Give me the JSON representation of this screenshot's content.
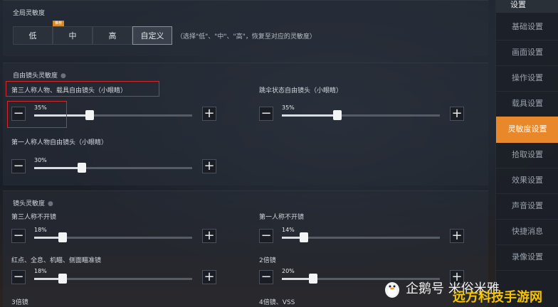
{
  "sections": {
    "global": {
      "title": "全局灵敏度",
      "presets": [
        "低",
        "中",
        "高",
        "自定义"
      ],
      "preset_tag": "推荐",
      "active_preset": "自定义",
      "hint": "（选择\"低\"、\"中\"、\"高\"，恢复至对应的灵敏度）"
    },
    "free_camera": {
      "title": "自由镜头灵敏度",
      "sliders": [
        {
          "label": "第三人称人物、载具自由镜头（小眼睛）",
          "value_text": "35%",
          "value": 35
        },
        {
          "label": "跳伞状态自由镜头（小眼睛）",
          "value_text": "35%",
          "value": 35
        },
        {
          "label": "第一人称人物自由镜头（小眼睛）",
          "value_text": "30%",
          "value": 30
        }
      ]
    },
    "lens": {
      "title": "镜头灵敏度",
      "sliders": [
        {
          "label": "第三人称不开镜",
          "value_text": "18%",
          "value": 18
        },
        {
          "label": "第一人称不开镜",
          "value_text": "14%",
          "value": 14
        },
        {
          "label": "红点、全息、机瞄、侧面瞄准镜",
          "value_text": "18%",
          "value": 18
        },
        {
          "label": "2倍镜",
          "value_text": "20%",
          "value": 20
        }
      ],
      "partial_labels": [
        "3倍镜",
        "4倍镜、VSS"
      ]
    }
  },
  "controls": {
    "minus": "−",
    "plus": "+"
  },
  "sidebar": {
    "title": "设置",
    "items": [
      "基础设置",
      "画面设置",
      "操作设置",
      "载具设置",
      "灵敏度设置",
      "拾取设置",
      "效果设置",
      "声音设置",
      "快捷消息",
      "录像设置"
    ],
    "active": "灵敏度设置"
  },
  "watermark": {
    "text": "企鹅号 米俗米雅",
    "text2": "远方科技手游网"
  },
  "colors": {
    "accent": "#e8882a",
    "highlight_box": "#d22a2a",
    "background": "#1c2129"
  }
}
